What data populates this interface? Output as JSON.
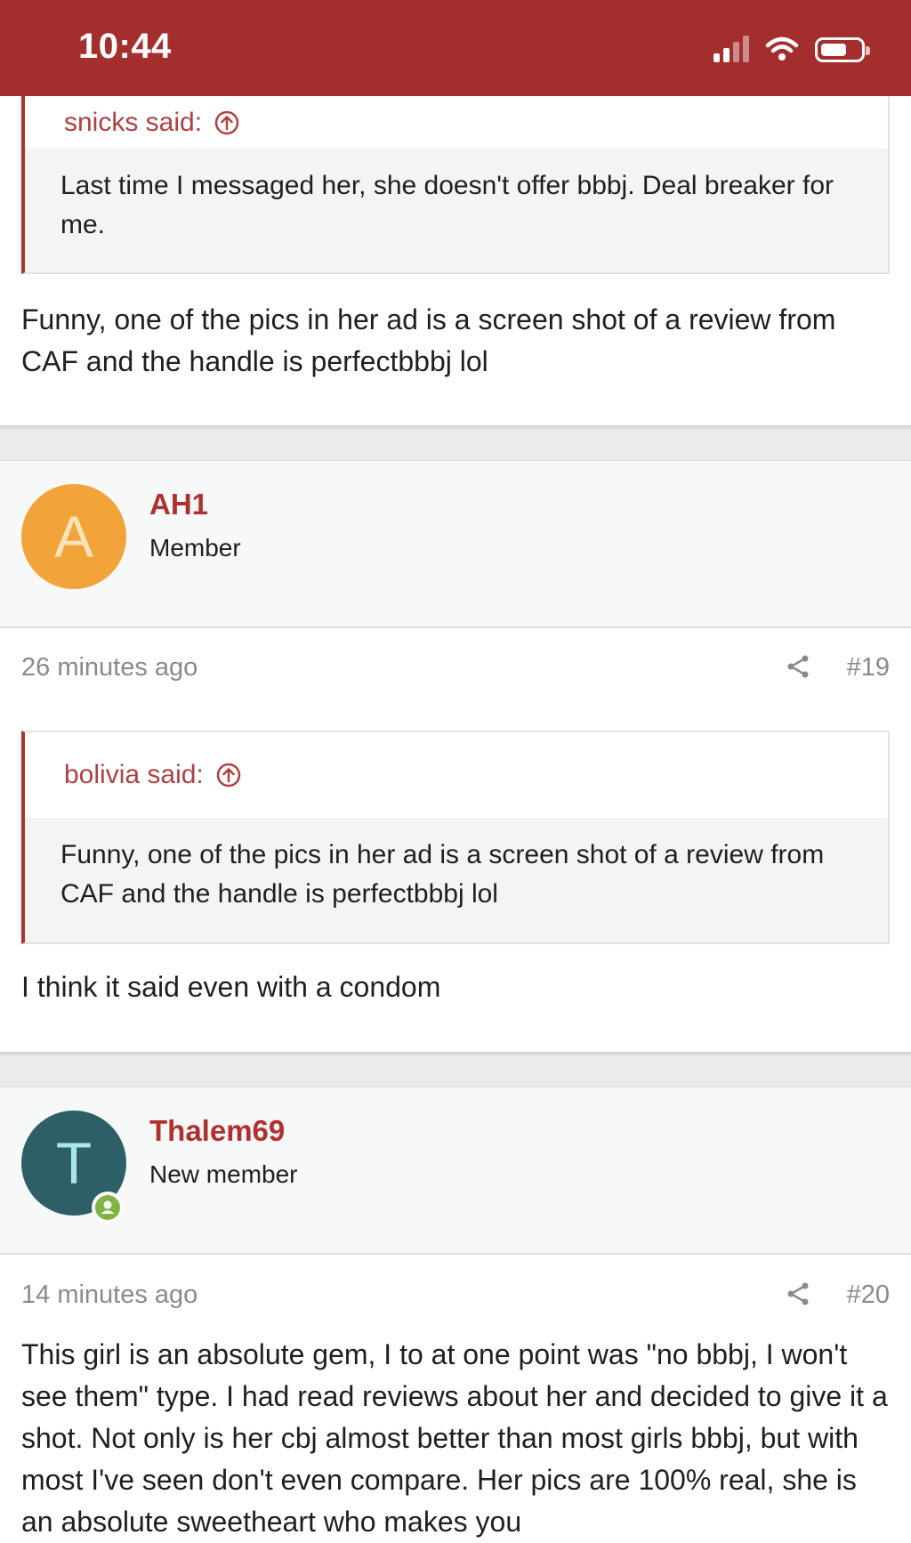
{
  "status_bar": {
    "time": "10:44"
  },
  "post_top": {
    "quote_author": "snicks said:",
    "quote_text": "Last time I messaged her, she doesn't offer bbbj. Deal breaker for me.",
    "message": "Funny, one of the pics in her ad is a screen shot of a review from CAF and the handle is perfectbbbj lol"
  },
  "post_19": {
    "avatar_letter": "A",
    "avatar_color": "#f2a33a",
    "username": "AH1",
    "role": "Member",
    "timestamp": "26 minutes ago",
    "post_number": "#19",
    "quote_author": "bolivia said:",
    "quote_text": "Funny, one of the pics in her ad is a screen shot of a review from CAF and the handle is perfectbbbj lol",
    "message": "I think it said even with a condom"
  },
  "post_20": {
    "avatar_letter": "T",
    "avatar_color": "#2c5f66",
    "username": "Thalem69",
    "role": "New member",
    "timestamp": "14 minutes ago",
    "post_number": "#20",
    "message": "This girl is an absolute gem, I to at one point was \"no bbbj, I won't see them\" type. I had read reviews about her and decided to give it a shot. Not only is her cbj almost better than most girls bbbj, but with most I've seen don't even compare. Her pics are 100% real, she is an absolute sweetheart who makes you"
  },
  "colors": {
    "brand": "#a42e2e",
    "username": "#b03030",
    "online": "#7fb342"
  }
}
